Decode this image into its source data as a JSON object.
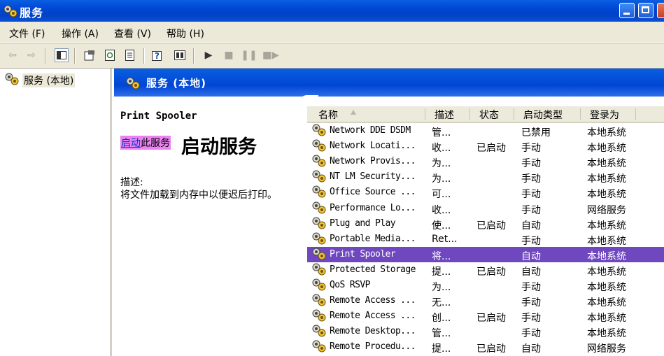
{
  "window": {
    "title": "服务"
  },
  "menu": [
    "文件 (F)",
    "操作 (A)",
    "查看 (V)",
    "帮助 (H)"
  ],
  "tree": {
    "root_label": "服务 (本地)"
  },
  "panel": {
    "header": "服务 (本地)",
    "service_name": "Print Spooler",
    "start_link_highlight": "启动",
    "start_link_rest": "此服务",
    "start_big_text": "启动服务",
    "desc_label": "描述:",
    "desc_text": "将文件加载到内存中以便迟后打印。"
  },
  "columns": [
    "名称",
    "描述",
    "状态",
    "启动类型",
    "登录为"
  ],
  "services": [
    {
      "name": "Network DDE DSDM",
      "desc": "管...",
      "status": "",
      "startup": "已禁用",
      "logon": "本地系统"
    },
    {
      "name": "Network Locati...",
      "desc": "收...",
      "status": "已启动",
      "startup": "手动",
      "logon": "本地系统"
    },
    {
      "name": "Network Provis...",
      "desc": "为...",
      "status": "",
      "startup": "手动",
      "logon": "本地系统"
    },
    {
      "name": "NT LM Security...",
      "desc": "为...",
      "status": "",
      "startup": "手动",
      "logon": "本地系统"
    },
    {
      "name": "Office Source ...",
      "desc": "可...",
      "status": "",
      "startup": "手动",
      "logon": "本地系统"
    },
    {
      "name": "Performance Lo...",
      "desc": "收...",
      "status": "",
      "startup": "手动",
      "logon": "网络服务"
    },
    {
      "name": "Plug and Play",
      "desc": "使...",
      "status": "已启动",
      "startup": "自动",
      "logon": "本地系统"
    },
    {
      "name": "Portable Media...",
      "desc": "Ret...",
      "status": "",
      "startup": "手动",
      "logon": "本地系统"
    },
    {
      "name": "Print Spooler",
      "desc": "将...",
      "status": "",
      "startup": "自动",
      "logon": "本地系统",
      "selected": true
    },
    {
      "name": "Protected Storage",
      "desc": "提...",
      "status": "已启动",
      "startup": "自动",
      "logon": "本地系统"
    },
    {
      "name": "QoS RSVP",
      "desc": "为...",
      "status": "",
      "startup": "手动",
      "logon": "本地系统"
    },
    {
      "name": "Remote Access ...",
      "desc": "无...",
      "status": "",
      "startup": "手动",
      "logon": "本地系统"
    },
    {
      "name": "Remote Access ...",
      "desc": "创...",
      "status": "已启动",
      "startup": "手动",
      "logon": "本地系统"
    },
    {
      "name": "Remote Desktop...",
      "desc": "管...",
      "status": "",
      "startup": "手动",
      "logon": "本地系统"
    },
    {
      "name": "Remote Procedu...",
      "desc": "提...",
      "status": "已启动",
      "startup": "自动",
      "logon": "网络服务"
    }
  ],
  "colors": {
    "titlebar": "#0046d5",
    "selection": "#6f48c0",
    "link_highlight": "#ea82f0",
    "chrome": "#ece9d8"
  }
}
